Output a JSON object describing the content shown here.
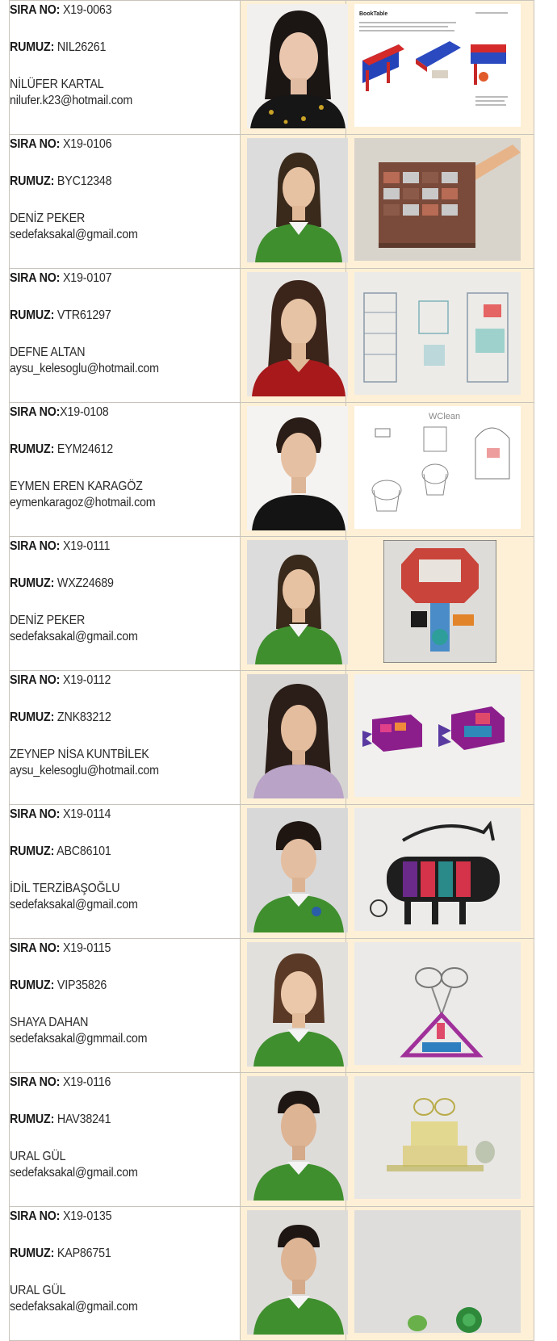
{
  "labels": {
    "sira": "SIRA NO:",
    "rumuz": "RUMUZ:"
  },
  "rows": [
    {
      "sira_value": "X19-0063",
      "rumuz_value": "NIL26261",
      "name": "NİLÜFER KARTAL",
      "email": "nilufer.k23@hotmail.com",
      "drawing_title": "BookTable"
    },
    {
      "sira_value": "X19-0106",
      "rumuz_value": "BYC12348",
      "name": "DENİZ PEKER",
      "email": "sedefaksakal@gmail.com"
    },
    {
      "sira_value": "X19-0107",
      "rumuz_value": "VTR61297",
      "name": "DEFNE ALTAN",
      "email": "aysu_kelesoglu@hotmail.com"
    },
    {
      "sira_value": "X19-0108",
      "rumuz_value": "EYM24612",
      "name": "EYMEN EREN KARAGÖZ",
      "email": "eymenkaragoz@hotmail.com",
      "drawing_title": "WClean"
    },
    {
      "sira_value": "X19-0111",
      "rumuz_value": "WXZ24689",
      "name": "DENİZ PEKER",
      "email": "sedefaksakal@gmail.com"
    },
    {
      "sira_value": "X19-0112",
      "rumuz_value": "ZNK83212",
      "name": "ZEYNEP NİSA KUNTBİLEK",
      "email": "aysu_kelesoglu@hotmail.com"
    },
    {
      "sira_value": "X19-0114",
      "rumuz_value": "ABC86101",
      "name": "İDİL TERZİBAŞOĞLU",
      "email": "sedefaksakal@gmail.com"
    },
    {
      "sira_value": "X19-0115",
      "rumuz_value": "VIP35826",
      "name": "SHAYA DAHAN",
      "email": "sedefaksakal@gmmail.com"
    },
    {
      "sira_value": "X19-0116",
      "rumuz_value": "HAV38241",
      "name": "URAL GÜL",
      "email": "sedefaksakal@gmail.com"
    },
    {
      "sira_value": "X19-0135",
      "rumuz_value": "KAP86751",
      "name": "URAL GÜL",
      "email": "sedefaksakal@gmail.com"
    }
  ],
  "colors": {
    "border": "#c9c4bb",
    "cell_bg": "#fdf0d6",
    "shirt_green": "#3f8f2e",
    "shirt_red": "#a8191b",
    "shirt_black": "#141414",
    "shirt_lilac": "#b9a3c6"
  }
}
